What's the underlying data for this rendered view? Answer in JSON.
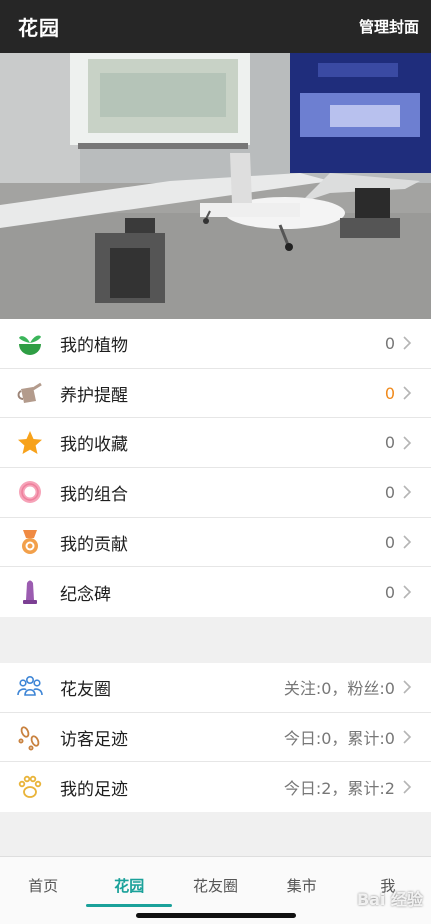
{
  "header": {
    "title": "花园",
    "action_label": "管理封面"
  },
  "group1": [
    {
      "icon": "sprout-icon",
      "label": "我的植物",
      "value": "0",
      "value_color": "#777777"
    },
    {
      "icon": "watering-can-icon",
      "label": "养护提醒",
      "value": "0",
      "value_color": "#f08a1c"
    },
    {
      "icon": "star-icon",
      "label": "我的收藏",
      "value": "0",
      "value_color": "#777777"
    },
    {
      "icon": "ring-icon",
      "label": "我的组合",
      "value": "0",
      "value_color": "#777777"
    },
    {
      "icon": "medal-icon",
      "label": "我的贡献",
      "value": "0",
      "value_color": "#777777"
    },
    {
      "icon": "monument-icon",
      "label": "纪念碑",
      "value": "0",
      "value_color": "#777777"
    }
  ],
  "group2": [
    {
      "icon": "friends-icon",
      "label": "花友圈",
      "value": "关注:0，粉丝:0"
    },
    {
      "icon": "footprints-icon",
      "label": "访客足迹",
      "value": "今日:0，累计:0"
    },
    {
      "icon": "paw-icon",
      "label": "我的足迹",
      "value": "今日:2，累计:2"
    }
  ],
  "tabbar": {
    "tabs": [
      "首页",
      "花园",
      "花友圈",
      "集市",
      "我"
    ],
    "active": "花园"
  },
  "watermark": "Bai 经验",
  "colors": {
    "accent": "#1aa19a",
    "header_bg": "#262626",
    "orange": "#f08a1c"
  }
}
